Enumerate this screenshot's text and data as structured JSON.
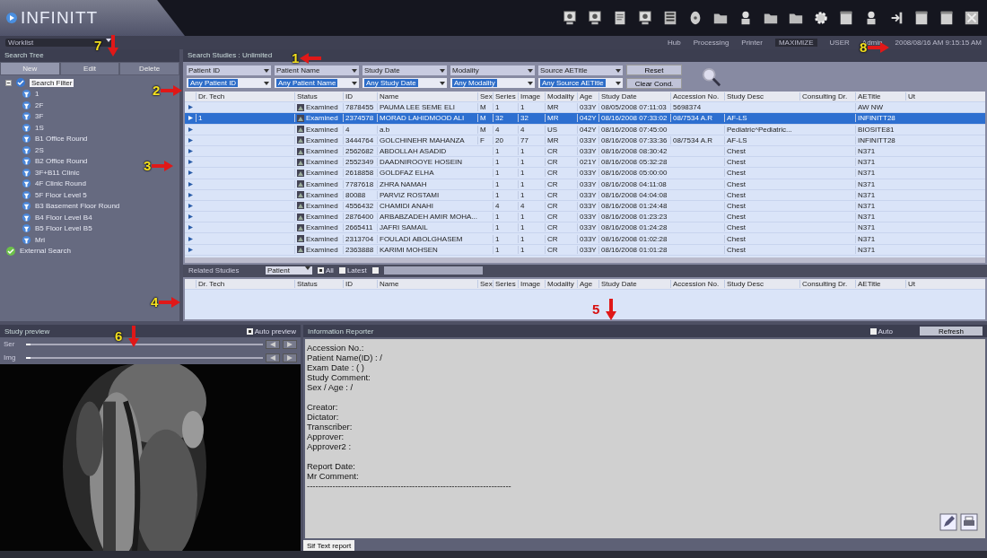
{
  "app": {
    "logo": "INFINITT",
    "worklist": "Worklist"
  },
  "status": [
    {
      "kind": "icon",
      "text": "Hub"
    },
    {
      "kind": "icon",
      "text": "Processing"
    },
    {
      "kind": "icon",
      "text": "Printer"
    },
    {
      "kind": "select",
      "text": "MAXIMIZE"
    },
    {
      "kind": "plain",
      "text": "USER"
    },
    {
      "kind": "plain",
      "text": "Admin"
    },
    {
      "kind": "plain",
      "text": "2008/08/16 AM 9:15:15 AM"
    }
  ],
  "search_tree": {
    "title": "Search Tree",
    "tabs": [
      {
        "label": "New",
        "selected": true
      },
      {
        "label": "Edit",
        "selected": false
      },
      {
        "label": "Delete",
        "selected": false
      }
    ],
    "tree": [
      {
        "label": "Search Filter",
        "selected": true,
        "expanded": true,
        "kind": "root",
        "children": [
          {
            "label": "1"
          },
          {
            "label": "2F"
          },
          {
            "label": "3F"
          },
          {
            "label": "1S"
          },
          {
            "label": "B1 Office Round"
          },
          {
            "label": "2S"
          },
          {
            "label": "B2 Office Round"
          },
          {
            "label": "3F+B11 Clinic"
          },
          {
            "label": "4F Clinic Round"
          },
          {
            "label": "5F Floor Level 5"
          },
          {
            "label": "B3 Basement Floor Round"
          },
          {
            "label": "B4 Floor Level B4"
          },
          {
            "label": "B5 Floor Level B5"
          },
          {
            "label": "Mri"
          }
        ]
      },
      {
        "label": "External Search",
        "selected": false,
        "kind": "external"
      }
    ]
  },
  "search_studies": {
    "title": "Search Studies : Unlimited",
    "filters": [
      {
        "field": "Patient ID",
        "value": "Any Patient ID"
      },
      {
        "field": "Patient Name",
        "value": "Any Patient Name"
      },
      {
        "field": "Study Date",
        "value": "Any Study Date"
      },
      {
        "field": "Modality",
        "value": "Any Modality"
      },
      {
        "field": "Source AETitle",
        "value": "Any Source AETitle"
      }
    ],
    "buttons": [
      "Reset",
      "Clear Cond."
    ]
  },
  "table": {
    "columns": [
      "Dr. Tech",
      "Status",
      "ID",
      "Name",
      "Sex",
      "Series",
      "Image",
      "Modality",
      "Age",
      "Study Date",
      "Accession No.",
      "Study Desc",
      "Consulting Dr.",
      "AETitle",
      "Ut"
    ],
    "rows": [
      {
        "selected": false,
        "status": "Examined",
        "id": "7878455",
        "name": "PAUMA LEE SEME ELI",
        "sex": "M",
        "series": "1",
        "image": "1",
        "modality": "MR",
        "age": "033Y",
        "date": "08/05/2008 07:11:03",
        "accession": "5698374",
        "ae": "AW NW"
      },
      {
        "selected": true,
        "tech": "1",
        "status": "Examined",
        "id": "2374578",
        "name": "MORAD LAHIDMOOD ALI",
        "sex": "M",
        "series": "32",
        "image": "32",
        "modality": "MR",
        "age": "042Y",
        "date": "08/16/2008 07:33:02",
        "accession": "08/7534  A.R",
        "desc": "AF-LS",
        "ae": "INFINITT28"
      },
      {
        "selected": false,
        "status": "Examined",
        "id": "4",
        "name": "a.b",
        "sex": "M",
        "series": "4",
        "image": "4",
        "modality": "US",
        "age": "042Y",
        "date": "08/16/2008 07:45:00",
        "desc": "Pediatric^Pediatric...",
        "ae": "BIOSITE81"
      },
      {
        "selected": false,
        "status": "Examined",
        "id": "3444764",
        "name": "GOLCHINEHR MAHANZA",
        "sex": "F",
        "series": "20",
        "image": "77",
        "modality": "MR",
        "age": "033Y",
        "date": "08/16/2008 07:33:36",
        "accession": "08/7534  A.R",
        "desc": "AF-LS",
        "ae": "INFINITT28"
      },
      {
        "selected": false,
        "status": "Examined",
        "id": "2562682",
        "name": "ABDOLLAH ASADID",
        "series": "1",
        "image": "1",
        "modality": "CR",
        "age": "033Y",
        "date": "08/16/2008 08:30:42",
        "desc": "Chest",
        "ae": "N371"
      },
      {
        "selected": false,
        "status": "Examined",
        "id": "2552349",
        "name": "DAADNIROOYE HOSEIN",
        "series": "1",
        "image": "1",
        "modality": "CR",
        "age": "021Y",
        "date": "08/16/2008 05:32:28",
        "desc": "Chest",
        "ae": "N371"
      },
      {
        "selected": false,
        "status": "Examined",
        "id": "2618858",
        "name": "GOLDFAZ ELHA",
        "series": "1",
        "image": "1",
        "modality": "CR",
        "age": "033Y",
        "date": "08/16/2008 05:00:00",
        "desc": "Chest",
        "ae": "N371"
      },
      {
        "selected": false,
        "status": "Examined",
        "id": "7787618",
        "name": "ZHRA NAMAH",
        "series": "1",
        "image": "1",
        "modality": "CR",
        "age": "033Y",
        "date": "08/16/2008 04:11:08",
        "desc": "Chest",
        "ae": "N371"
      },
      {
        "selected": false,
        "status": "Examined",
        "id": "80088",
        "name": "PARVIZ ROSTAMI",
        "series": "1",
        "image": "1",
        "modality": "CR",
        "age": "033Y",
        "date": "08/16/2008 04:04:08",
        "desc": "Chest",
        "ae": "N371"
      },
      {
        "selected": false,
        "status": "Examined",
        "id": "4556432",
        "name": "CHAMIDI ANAHI",
        "series": "4",
        "image": "4",
        "modality": "CR",
        "age": "033Y",
        "date": "08/16/2008 01:24:48",
        "desc": "Chest",
        "ae": "N371"
      },
      {
        "selected": false,
        "status": "Examined",
        "id": "2876400",
        "name": "ARBABZADEH AMIR MOHA...",
        "series": "1",
        "image": "1",
        "modality": "CR",
        "age": "033Y",
        "date": "08/16/2008 01:23:23",
        "desc": "Chest",
        "ae": "N371"
      },
      {
        "selected": false,
        "status": "Examined",
        "id": "2665411",
        "name": "JAFRI SAMAIL",
        "series": "1",
        "image": "1",
        "modality": "CR",
        "age": "033Y",
        "date": "08/16/2008 01:24:28",
        "desc": "Chest",
        "ae": "N371"
      },
      {
        "selected": false,
        "status": "Examined",
        "id": "2313704",
        "name": "FOULADI ABOLGHASEM",
        "series": "1",
        "image": "1",
        "modality": "CR",
        "age": "033Y",
        "date": "08/16/2008 01:02:28",
        "desc": "Chest",
        "ae": "N371"
      },
      {
        "selected": false,
        "status": "Examined",
        "id": "2363888",
        "name": "KARIMI MOHSEN",
        "series": "1",
        "image": "1",
        "modality": "CR",
        "age": "033Y",
        "date": "08/16/2008 01:01:28",
        "desc": "Chest",
        "ae": "N371"
      }
    ]
  },
  "related": {
    "title": "Related Studies",
    "select": "Patient",
    "options": [
      {
        "label": "All",
        "checked": true
      },
      {
        "label": "Latest",
        "checked": false
      },
      {
        "checked": false
      }
    ],
    "columns": [
      "Dr. Tech",
      "Status",
      "ID",
      "Name",
      "Sex",
      "Series",
      "Image",
      "Modality",
      "Age",
      "Study Date",
      "Accession No.",
      "Study Desc",
      "Consulting Dr.",
      "AETitle",
      "Ut"
    ]
  },
  "preview": {
    "title": "Study preview",
    "auto_preview": {
      "label": "Auto preview",
      "checked": true
    },
    "sliders": [
      {
        "label": "Ser",
        "level": 0.02
      },
      {
        "label": "Img",
        "level": 0.02
      }
    ]
  },
  "reporter": {
    "title": "Information Reporter",
    "auto": {
      "label": "Auto",
      "checked": false
    },
    "refresh": "Refresh",
    "line_groups": [
      [
        "Accession No.:",
        "Patient Name(ID) : /",
        "Exam Date : ( )",
        "Study Comment:",
        "Sex / Age : /"
      ],
      [
        "Creator:",
        "Dictator:",
        "Transcriber:",
        "Approver:",
        "Approver2 :"
      ],
      [
        "Report Date:",
        "Mr Comment:",
        "------------------------------------------------------------------------"
      ]
    ],
    "tabs": [
      {
        "label": "Sif Text report",
        "selected": true
      }
    ]
  },
  "annotations": [
    "1",
    "2",
    "3",
    "4",
    "5",
    "6",
    "7",
    "8"
  ]
}
